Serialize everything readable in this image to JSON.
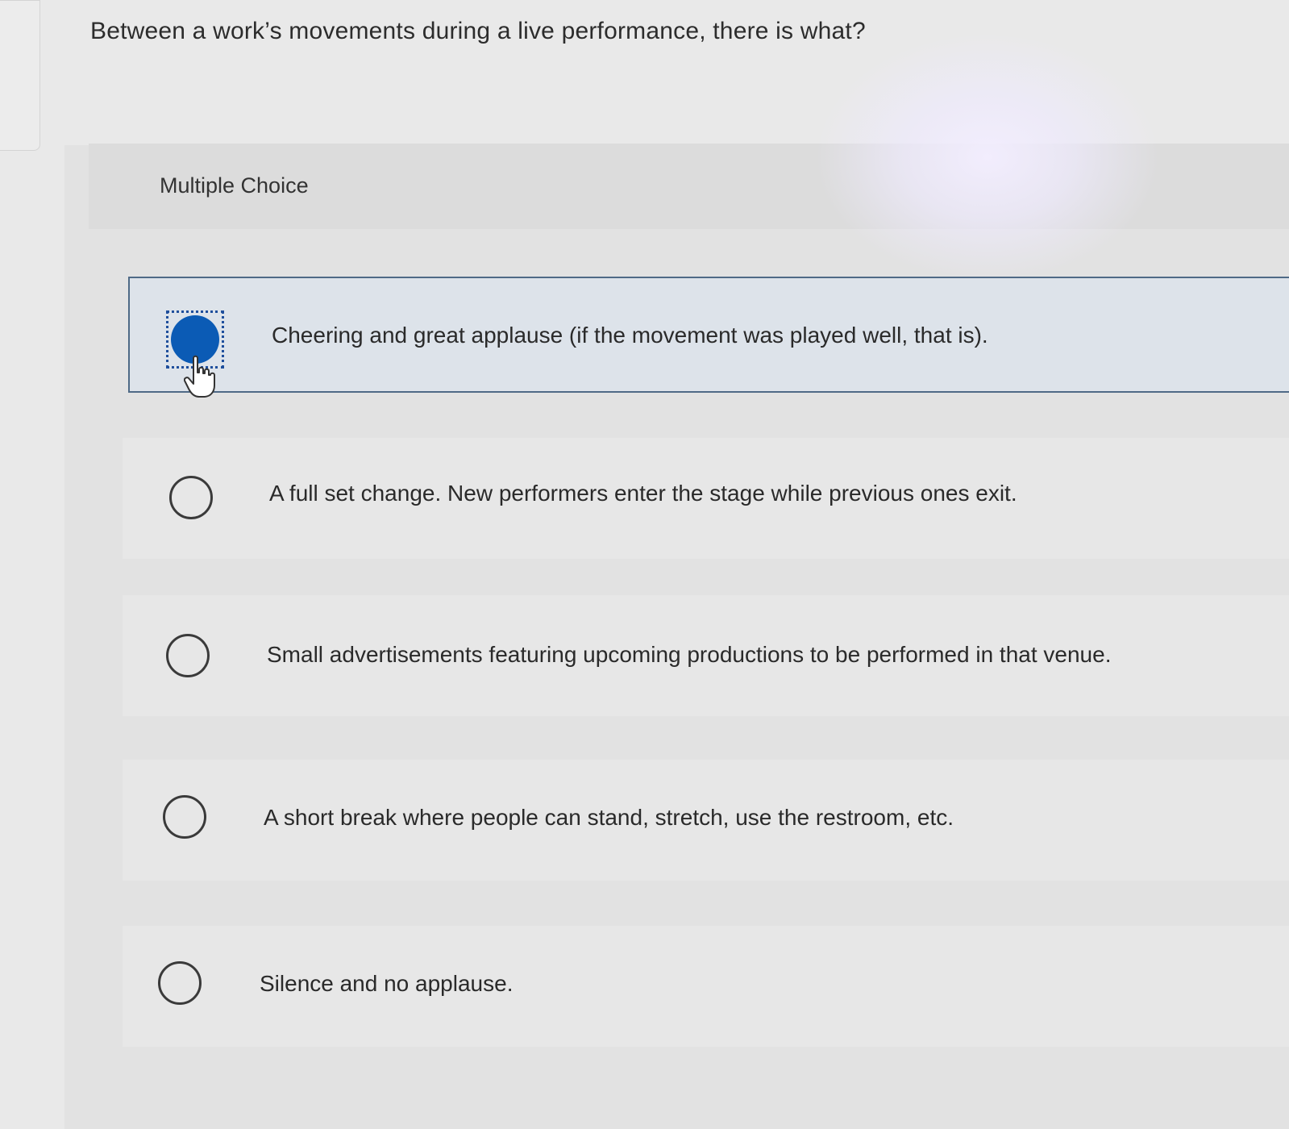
{
  "question": {
    "text": "Between a work’s movements during a live performance, there is what?"
  },
  "section": {
    "label": "Multiple Choice"
  },
  "choices": [
    {
      "text": "Cheering and great applause (if the movement was played well, that is).",
      "selected": true
    },
    {
      "text": "A full set change. New performers enter the stage while previous ones exit.",
      "selected": false
    },
    {
      "text": "Small advertisements featuring upcoming productions to be performed in that venue.",
      "selected": false
    },
    {
      "text": "A short break where people can stand, stretch, use the restroom, etc.",
      "selected": false
    },
    {
      "text": "Silence and no applause.",
      "selected": false
    }
  ],
  "colors": {
    "selected_radio": "#0b5bb5",
    "selected_border": "#4f6a86",
    "selected_background": "#dde3ea"
  },
  "icons": {
    "cursor": "hand-pointer-icon"
  }
}
